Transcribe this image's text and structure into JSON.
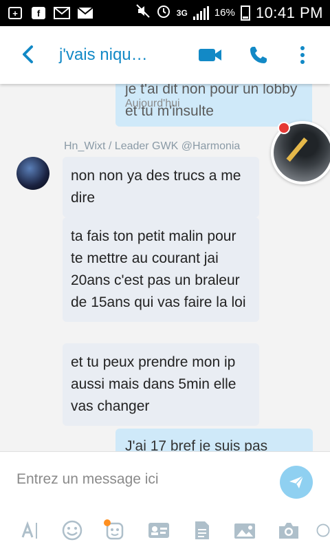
{
  "status_bar": {
    "network": "3G",
    "battery": "16%",
    "time": "10:41 PM",
    "icons": [
      "plus-square-icon",
      "facebook-icon",
      "mail-check-icon",
      "mail-icon",
      "mute-icon",
      "alarm-icon",
      "signal-icon",
      "battery-icon"
    ]
  },
  "header": {
    "title": "j'vais niqu…",
    "icons": [
      "back-icon",
      "video-call-icon",
      "phone-icon",
      "more-vert-icon"
    ],
    "accent": "#1289c6"
  },
  "chat": {
    "outgoing_top": "je t'ai dit non pour un lobby et tu m'insulte",
    "day_label": "Aujourd'hui",
    "sender": "Hn_Wixt / Leader GWK @Harmonia",
    "messages": [
      "non non ya des trucs a me dire",
      "ta fais ton petit malin pour te mettre au courant jai 20ans c'est pas un braleur de 15ans qui vas faire la loi",
      "et tu peux prendre mon ip aussi mais dans 5min elle vas changer"
    ],
    "outgoing_bottom": "J'ai 17 bref je suis pas"
  },
  "composer": {
    "placeholder": "Entrez un message ici",
    "tools": [
      "text-format-icon",
      "emoji-icon",
      "mojis-icon",
      "contact-card-icon",
      "file-icon",
      "image-icon",
      "camera-icon",
      "more-icon"
    ]
  },
  "colors": {
    "outgoing_bubble": "#cfe9f9",
    "incoming_bubble": "#e9edf3",
    "send_button": "#8fd0f1"
  }
}
